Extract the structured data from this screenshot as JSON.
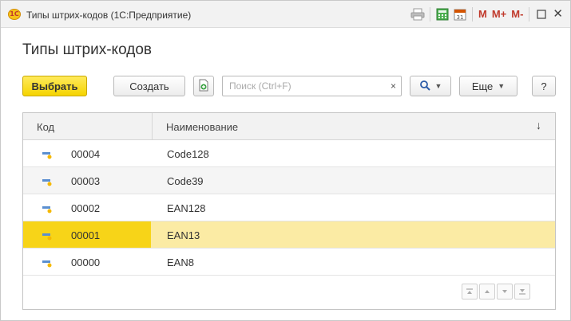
{
  "window": {
    "app_logo_text": "1С",
    "title": "Типы штрих-кодов  (1С:Предприятие)",
    "title_controls": {
      "m": "M",
      "m_plus": "M+",
      "m_minus": "M-",
      "close": "✕",
      "calendar_day": "31"
    }
  },
  "page": {
    "title": "Типы штрих-кодов"
  },
  "toolbar": {
    "select_label": "Выбрать",
    "create_label": "Создать",
    "search_placeholder": "Поиск (Ctrl+F)",
    "search_clear": "×",
    "more_label": "Еще",
    "help_label": "?"
  },
  "table": {
    "columns": [
      "Код",
      "Наименование"
    ],
    "sort_indicator": "↓",
    "rows": [
      {
        "code": "00004",
        "name": "Code128",
        "selected": false
      },
      {
        "code": "00003",
        "name": "Code39",
        "selected": false
      },
      {
        "code": "00002",
        "name": "EAN128",
        "selected": false
      },
      {
        "code": "00001",
        "name": "EAN13",
        "selected": true
      },
      {
        "code": "00000",
        "name": "EAN8",
        "selected": false
      }
    ]
  },
  "colors": {
    "primary_button": "#f5d400",
    "selected_row": "#fbeba4",
    "selected_cell": "#f7d418",
    "accent_red": "#c0392b"
  }
}
